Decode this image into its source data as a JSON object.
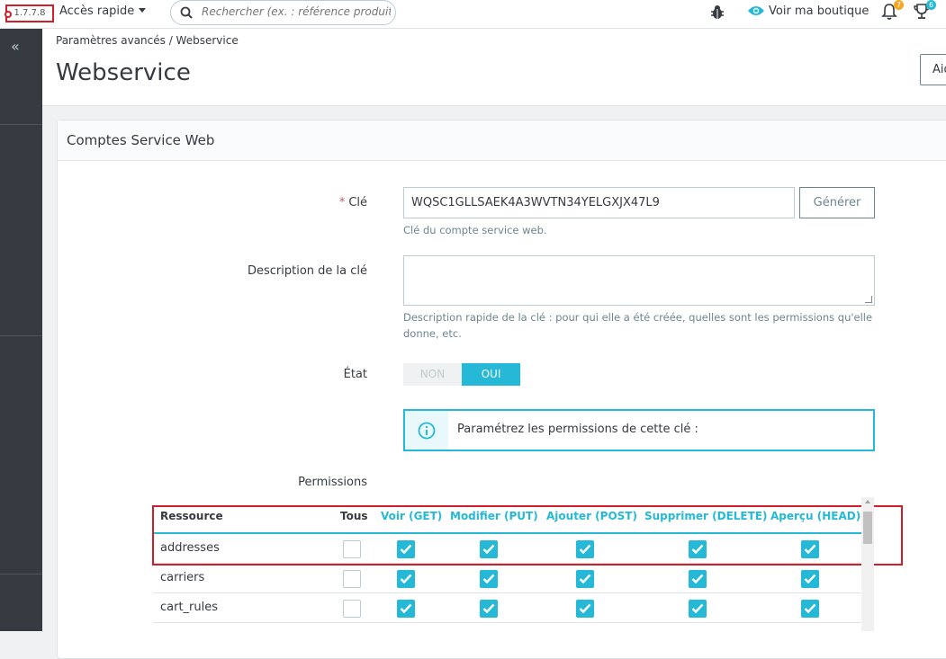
{
  "topbar": {
    "version": "1.7.7.8",
    "quick_access": "Accès rapide",
    "search_placeholder": "Rechercher (ex. : référence produit, nom",
    "view_shop": "Voir ma boutique",
    "notif_count": "7",
    "trophy_count": "6"
  },
  "sidebar": {
    "collapse_label": "«"
  },
  "header": {
    "breadcrumb": "Paramètres avancés  /  Webservice",
    "title": "Webservice",
    "help_button": "Aide"
  },
  "panel": {
    "title": "Comptes Service Web",
    "key_label": "Clé",
    "key_value": "WQSC1GLLSAEK4A3WVTN34YELGXJX47L9",
    "generate_button": "Générer",
    "key_help": "Clé du compte service web.",
    "description_label": "Description de la clé",
    "description_help_1": "Description rapide de la clé : pour qui elle a été créée, quelles sont les permissions qu'elle",
    "description_help_2": "donne, etc.",
    "status_label": "État",
    "status_off": "NON",
    "status_on": "OUI",
    "info_text": "Paramétrez les permissions de cette clé :",
    "permissions_label": "Permissions"
  },
  "table": {
    "columns": [
      "Ressource",
      "Tous",
      "Voir (GET)",
      "Modifier (PUT)",
      "Ajouter (POST)",
      "Supprimer (DELETE)",
      "Aperçu (HEAD)"
    ],
    "rows": [
      {
        "name": "addresses",
        "all": false,
        "get": true,
        "put": true,
        "post": true,
        "delete": true,
        "head": true
      },
      {
        "name": "carriers",
        "all": false,
        "get": true,
        "put": true,
        "post": true,
        "delete": true,
        "head": true
      },
      {
        "name": "cart_rules",
        "all": false,
        "get": true,
        "put": true,
        "post": true,
        "delete": true,
        "head": true
      }
    ]
  },
  "colors": {
    "accent": "#25b9d7",
    "sidebar": "#363a41",
    "highlight": "#d01f2a"
  }
}
